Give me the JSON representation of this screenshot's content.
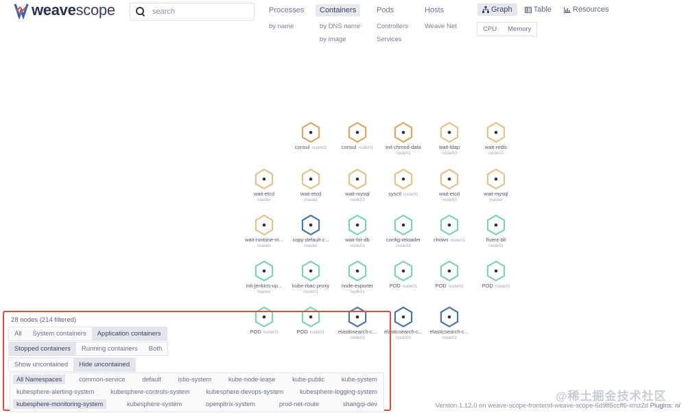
{
  "brand": {
    "name_bold": "weave",
    "name_light": "scope"
  },
  "search": {
    "placeholder": "search"
  },
  "topologies": [
    {
      "label": "Processes",
      "subs": [
        "by name"
      ]
    },
    {
      "label": "Containers",
      "active": true,
      "subs": [
        "by DNS name",
        "by image"
      ]
    },
    {
      "label": "Pods",
      "subs": [
        "Controllers",
        "Services"
      ]
    },
    {
      "label": "Hosts",
      "subs": [
        "Weave Net"
      ]
    }
  ],
  "views": {
    "graph": "Graph",
    "table": "Table",
    "resources": "Resources",
    "metrics": [
      "CPU",
      "Memory"
    ]
  },
  "colors": {
    "gold": "#e4c28c",
    "tan": "#d8a868",
    "blue": "#4a76a8",
    "green": "#7fd3b2",
    "dot": "#333333",
    "panel_border": "#e04a3f"
  },
  "nodes": [
    {
      "label": "consul",
      "host": "node03",
      "color": "tan"
    },
    {
      "label": "consul",
      "host": "node01",
      "color": "tan"
    },
    {
      "label": "init-chmod-data",
      "sub": "node01",
      "color": "tan"
    },
    {
      "label": "wait-ldap",
      "sub": "node03",
      "color": "gold"
    },
    {
      "label": "wait-redis",
      "sub": "node03",
      "color": "gold"
    },
    {
      "label": "wait-etcd",
      "sub": "master",
      "color": "gold"
    },
    {
      "label": "wait-etcd",
      "sub": "master",
      "color": "gold"
    },
    {
      "label": "wait-mysql",
      "sub": "node03",
      "color": "gold"
    },
    {
      "label": "sysctl",
      "host": "node01",
      "color": "gold"
    },
    {
      "label": "wait-etcd",
      "sub": "node03",
      "color": "gold"
    },
    {
      "label": "wait-mysql",
      "sub": "master",
      "color": "gold"
    },
    {
      "label": "wait-runtime-m...",
      "sub": "master",
      "color": "gold"
    },
    {
      "label": "copy-default-c...",
      "sub": "master",
      "color": "blue"
    },
    {
      "label": "wait-for-db",
      "sub": "node03",
      "color": "green"
    },
    {
      "label": "config-reloader",
      "sub": "node03",
      "color": "green"
    },
    {
      "label": "chown",
      "host": "node01",
      "color": "green"
    },
    {
      "label": "fluent-bit",
      "sub": "node01",
      "color": "green"
    },
    {
      "label": "init-jenkins-up...",
      "sub": "master",
      "color": "green"
    },
    {
      "label": "kube-rbac-proxy",
      "sub": "node01",
      "color": "green"
    },
    {
      "label": "node-exporter",
      "sub": "node01",
      "color": "green"
    },
    {
      "label": "POD",
      "host": "node01",
      "color": "green"
    },
    {
      "label": "POD",
      "host": "node03",
      "color": "green"
    },
    {
      "label": "POD",
      "host": "node03",
      "color": "green"
    },
    {
      "label": "POD",
      "host": "node03",
      "color": "green"
    },
    {
      "label": "POD",
      "host": "node01",
      "color": "green"
    },
    {
      "label": "elasticsearch-c...",
      "sub": "node03",
      "color": "blue"
    },
    {
      "label": "elasticsearch-c...",
      "sub": "node03",
      "color": "blue"
    },
    {
      "label": "elasticsearch-c...",
      "sub": "node03",
      "color": "blue"
    }
  ],
  "filters": {
    "node_count": "28 nodes (214 filtered)",
    "group1": [
      {
        "label": "All"
      },
      {
        "label": "System containers"
      },
      {
        "label": "Application containers",
        "active": true
      }
    ],
    "group2": [
      {
        "label": "Stopped containers",
        "active": true
      },
      {
        "label": "Running containers"
      },
      {
        "label": "Both"
      }
    ],
    "group3": [
      {
        "label": "Show uncontained"
      },
      {
        "label": "Hide uncontained",
        "active": true
      }
    ],
    "namespaces": [
      [
        {
          "label": "All Namespaces",
          "active": true
        },
        {
          "label": "common-service"
        },
        {
          "label": "default"
        },
        {
          "label": "istio-system"
        },
        {
          "label": "kube-node-lease"
        },
        {
          "label": "kube-public"
        },
        {
          "label": "kube-system"
        }
      ],
      [
        {
          "label": "kubesphere-alerting-system"
        },
        {
          "label": "kubesphere-controls-system"
        },
        {
          "label": "kubesphere-devops-system"
        },
        {
          "label": "kubesphere-logging-system"
        }
      ],
      [
        {
          "label": "kubesphere-monitoring-system",
          "active": true
        },
        {
          "label": "kubesphere-system"
        },
        {
          "label": "openpitrix-system"
        },
        {
          "label": "prod-net-route"
        },
        {
          "label": "shangqi-dev"
        }
      ]
    ]
  },
  "footer": {
    "version": "Version 1.12.0 on weave-scope-frontend-weave-scope-6d985ccff6-xmz2d",
    "plugins": "Plugins: n/"
  },
  "watermark": "@稀土掘金技术社区"
}
